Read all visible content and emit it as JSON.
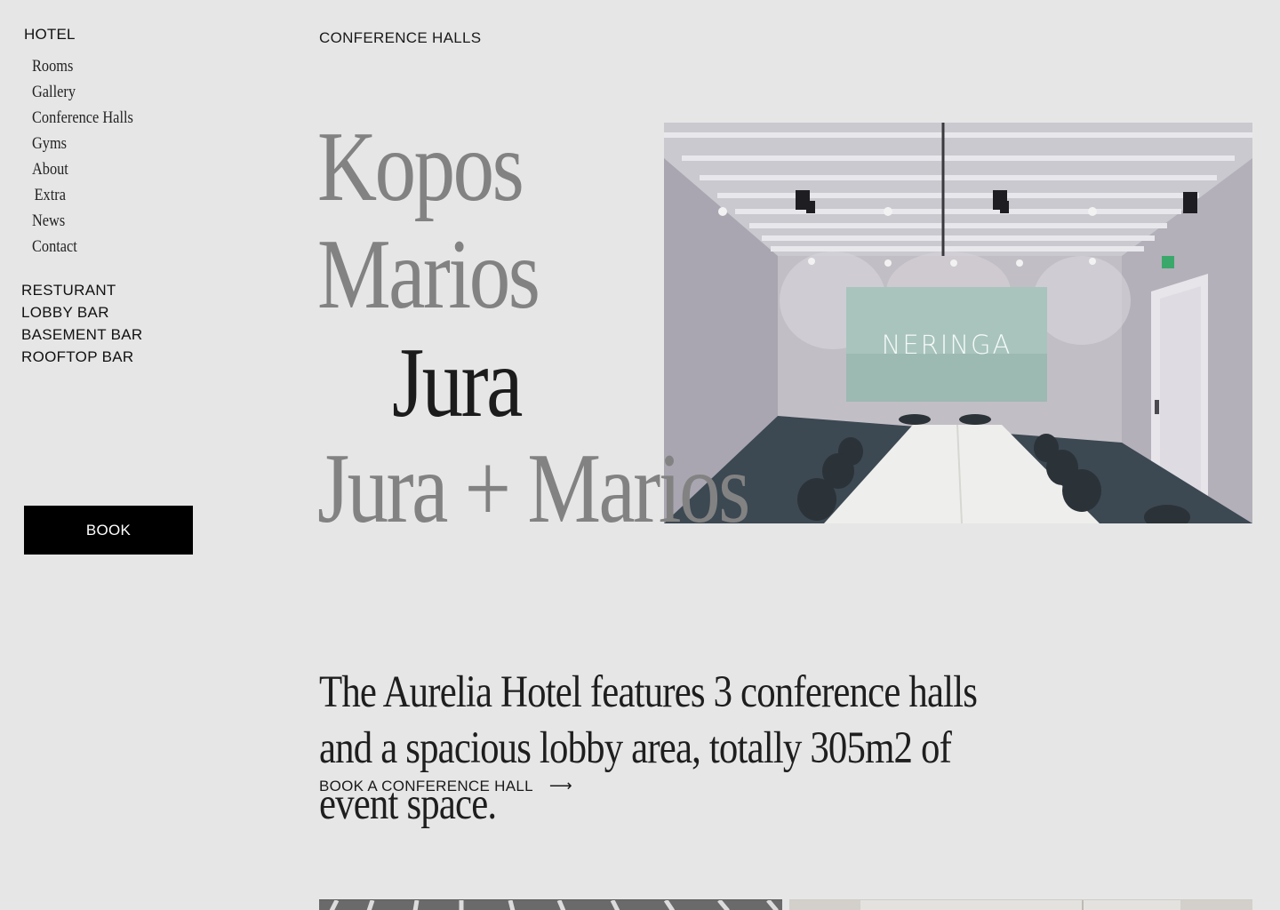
{
  "sidebar": {
    "heading": "HOTEL",
    "sub_items": [
      {
        "label": "Rooms"
      },
      {
        "label": "Gallery"
      },
      {
        "label": "Conference Halls"
      },
      {
        "label": "Gyms"
      },
      {
        "label": "About"
      },
      {
        "label": "Extra"
      },
      {
        "label": "News"
      },
      {
        "label": "Contact"
      }
    ],
    "venues": [
      {
        "label": "RESTURANT"
      },
      {
        "label": "LOBBY BAR"
      },
      {
        "label": "BASEMENT BAR"
      },
      {
        "label": "ROOFTOP BAR"
      }
    ],
    "book_label": "BOOK"
  },
  "main": {
    "title": "CONFERENCE HALLS",
    "halls": [
      {
        "label": "Kopos",
        "active": false
      },
      {
        "label": "Marios",
        "active": false
      },
      {
        "label": "Jura",
        "active": true
      },
      {
        "label": "Jura + Marios",
        "active": false
      }
    ],
    "hero": {
      "screen_text": "NERINGA"
    },
    "intro": "The Aurelia Hotel features 3 conference halls and a spacious lobby area, totally 305m2 of event space.",
    "cta_label": "BOOK A CONFERENCE HALL",
    "cta_icon": "arrow-right-icon"
  },
  "colors": {
    "background": "#e6e6e6",
    "text": "#1c1c1c",
    "muted_hall": "#828282",
    "button_bg": "#000000",
    "button_text": "#ffffff"
  }
}
